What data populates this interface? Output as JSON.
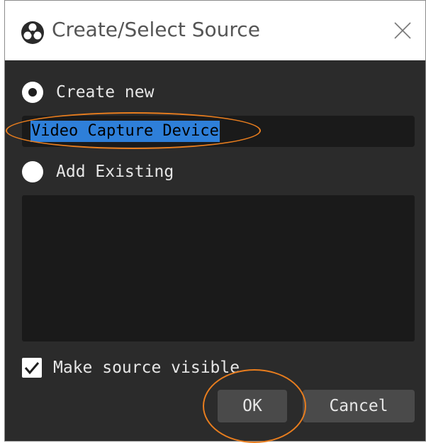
{
  "window": {
    "title": "Create/Select Source",
    "icon": "obs-logo-icon",
    "close_icon": "close-icon"
  },
  "options": {
    "create_new_label": "Create new",
    "create_new_selected": true,
    "source_name_value": "Video Capture Device",
    "add_existing_label": "Add Existing",
    "add_existing_selected": false,
    "existing_sources": []
  },
  "visibility": {
    "label": "Make source visible",
    "checked": true
  },
  "buttons": {
    "ok_label": "OK",
    "cancel_label": "Cancel"
  },
  "colors": {
    "dialog_background": "#2b2b2b",
    "field_background": "#1a1a1a",
    "selection_highlight": "#2e7fd9",
    "annotation": "#e87d1e"
  }
}
